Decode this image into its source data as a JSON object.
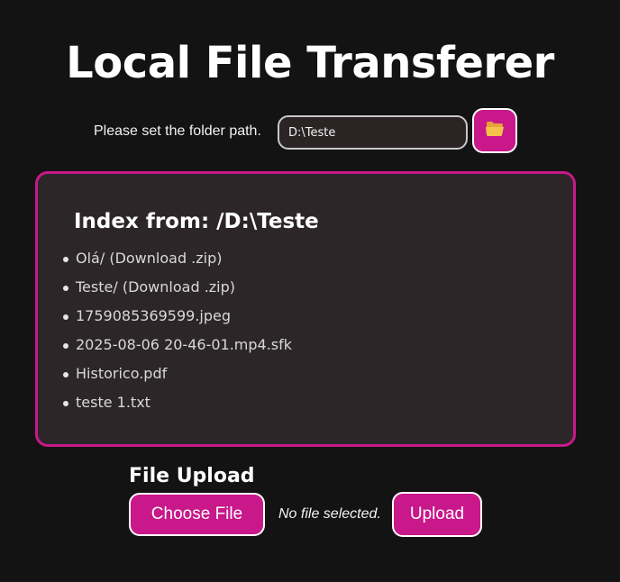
{
  "app": {
    "title": "Local File Transferer"
  },
  "path_form": {
    "label": "Please set the folder path.",
    "value": "D:\\Teste",
    "folder_icon": "folder-open-icon"
  },
  "index": {
    "title": "Index from: /D:\\Teste",
    "files": [
      "Olá/ (Download .zip)",
      "Teste/ (Download .zip)",
      "1759085369599.jpeg",
      "2025-08-06 20-46-01.mp4.sfk",
      "Historico.pdf",
      "teste 1.txt"
    ]
  },
  "upload": {
    "title": "File Upload",
    "choose_label": "Choose File",
    "status": "No file selected.",
    "upload_label": "Upload"
  },
  "colors": {
    "accent": "#c8188a",
    "background": "#131313",
    "panel": "#2c2628"
  }
}
